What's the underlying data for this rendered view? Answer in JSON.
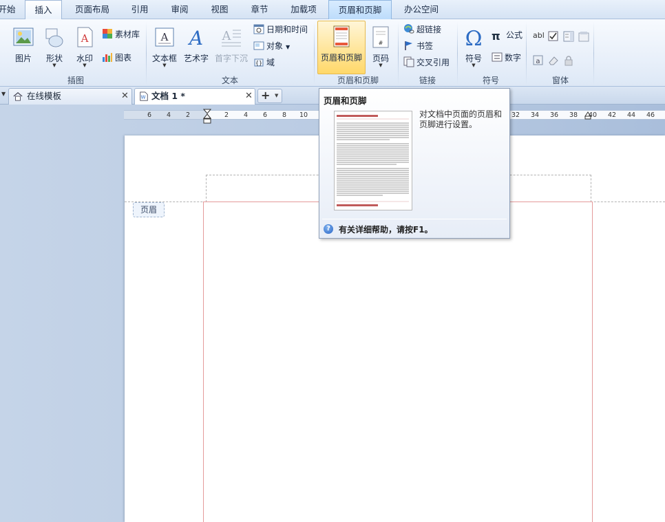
{
  "menu": {
    "items": [
      {
        "label": "开始"
      },
      {
        "label": "插入"
      },
      {
        "label": "页面布局"
      },
      {
        "label": "引用"
      },
      {
        "label": "审阅"
      },
      {
        "label": "视图"
      },
      {
        "label": "章节"
      },
      {
        "label": "加载项"
      },
      {
        "label": "页眉和页脚"
      },
      {
        "label": "办公空间"
      }
    ]
  },
  "ribbon": {
    "illustrations": {
      "group_label": "插图",
      "picture": "图片",
      "shapes": "形状",
      "watermark": "水印",
      "material_library": "素材库",
      "chart": "图表"
    },
    "text": {
      "group_label": "文本",
      "textbox": "文本框",
      "wordart": "艺术字",
      "dropcap": "首字下沉",
      "datetime": "日期和时间",
      "object": "对象",
      "field": "域"
    },
    "header_footer": {
      "group_label": "页眉和页脚",
      "header_footer": "页眉和页脚",
      "page_number": "页码"
    },
    "links": {
      "group_label": "链接",
      "hyperlink": "超链接",
      "bookmark": "书签",
      "cross_reference": "交叉引用"
    },
    "symbols": {
      "group_label": "符号",
      "symbol": "符号",
      "equation": "公式",
      "number": "数字"
    },
    "forms": {
      "group_label": "窗体",
      "textfield_glyph": "abl"
    }
  },
  "tabs": {
    "items": [
      {
        "label": "在线模板"
      },
      {
        "label": "文档 1 *"
      }
    ],
    "new_tab": "+"
  },
  "ruler": {
    "left_labels": [
      "6",
      "4",
      "2"
    ],
    "right_labels": [
      "2",
      "4",
      "6",
      "8",
      "10",
      "32",
      "34",
      "36",
      "38",
      "40",
      "42",
      "44",
      "46"
    ]
  },
  "document": {
    "header_tag": "页眉"
  },
  "tooltip": {
    "title": "页眉和页脚",
    "description": "对文档中页面的页眉和页脚进行设置。",
    "help": "有关详细帮助，请按F1。"
  },
  "colors": {
    "accent": "#ffd86a",
    "margin_guide": "#e49a9a",
    "ribbon_bg": "#e6eef9"
  }
}
